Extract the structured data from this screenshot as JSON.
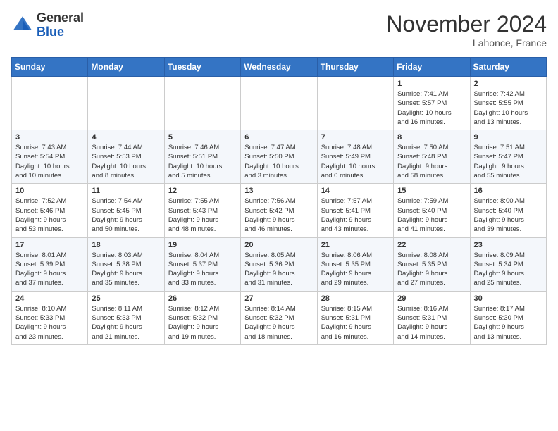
{
  "header": {
    "logo": {
      "general": "General",
      "blue": "Blue"
    },
    "month": "November 2024",
    "location": "Lahonce, France"
  },
  "weekdays": [
    "Sunday",
    "Monday",
    "Tuesday",
    "Wednesday",
    "Thursday",
    "Friday",
    "Saturday"
  ],
  "weeks": [
    [
      {
        "day": "",
        "info": ""
      },
      {
        "day": "",
        "info": ""
      },
      {
        "day": "",
        "info": ""
      },
      {
        "day": "",
        "info": ""
      },
      {
        "day": "",
        "info": ""
      },
      {
        "day": "1",
        "info": "Sunrise: 7:41 AM\nSunset: 5:57 PM\nDaylight: 10 hours\nand 16 minutes."
      },
      {
        "day": "2",
        "info": "Sunrise: 7:42 AM\nSunset: 5:55 PM\nDaylight: 10 hours\nand 13 minutes."
      }
    ],
    [
      {
        "day": "3",
        "info": "Sunrise: 7:43 AM\nSunset: 5:54 PM\nDaylight: 10 hours\nand 10 minutes."
      },
      {
        "day": "4",
        "info": "Sunrise: 7:44 AM\nSunset: 5:53 PM\nDaylight: 10 hours\nand 8 minutes."
      },
      {
        "day": "5",
        "info": "Sunrise: 7:46 AM\nSunset: 5:51 PM\nDaylight: 10 hours\nand 5 minutes."
      },
      {
        "day": "6",
        "info": "Sunrise: 7:47 AM\nSunset: 5:50 PM\nDaylight: 10 hours\nand 3 minutes."
      },
      {
        "day": "7",
        "info": "Sunrise: 7:48 AM\nSunset: 5:49 PM\nDaylight: 10 hours\nand 0 minutes."
      },
      {
        "day": "8",
        "info": "Sunrise: 7:50 AM\nSunset: 5:48 PM\nDaylight: 9 hours\nand 58 minutes."
      },
      {
        "day": "9",
        "info": "Sunrise: 7:51 AM\nSunset: 5:47 PM\nDaylight: 9 hours\nand 55 minutes."
      }
    ],
    [
      {
        "day": "10",
        "info": "Sunrise: 7:52 AM\nSunset: 5:46 PM\nDaylight: 9 hours\nand 53 minutes."
      },
      {
        "day": "11",
        "info": "Sunrise: 7:54 AM\nSunset: 5:45 PM\nDaylight: 9 hours\nand 50 minutes."
      },
      {
        "day": "12",
        "info": "Sunrise: 7:55 AM\nSunset: 5:43 PM\nDaylight: 9 hours\nand 48 minutes."
      },
      {
        "day": "13",
        "info": "Sunrise: 7:56 AM\nSunset: 5:42 PM\nDaylight: 9 hours\nand 46 minutes."
      },
      {
        "day": "14",
        "info": "Sunrise: 7:57 AM\nSunset: 5:41 PM\nDaylight: 9 hours\nand 43 minutes."
      },
      {
        "day": "15",
        "info": "Sunrise: 7:59 AM\nSunset: 5:40 PM\nDaylight: 9 hours\nand 41 minutes."
      },
      {
        "day": "16",
        "info": "Sunrise: 8:00 AM\nSunset: 5:40 PM\nDaylight: 9 hours\nand 39 minutes."
      }
    ],
    [
      {
        "day": "17",
        "info": "Sunrise: 8:01 AM\nSunset: 5:39 PM\nDaylight: 9 hours\nand 37 minutes."
      },
      {
        "day": "18",
        "info": "Sunrise: 8:03 AM\nSunset: 5:38 PM\nDaylight: 9 hours\nand 35 minutes."
      },
      {
        "day": "19",
        "info": "Sunrise: 8:04 AM\nSunset: 5:37 PM\nDaylight: 9 hours\nand 33 minutes."
      },
      {
        "day": "20",
        "info": "Sunrise: 8:05 AM\nSunset: 5:36 PM\nDaylight: 9 hours\nand 31 minutes."
      },
      {
        "day": "21",
        "info": "Sunrise: 8:06 AM\nSunset: 5:35 PM\nDaylight: 9 hours\nand 29 minutes."
      },
      {
        "day": "22",
        "info": "Sunrise: 8:08 AM\nSunset: 5:35 PM\nDaylight: 9 hours\nand 27 minutes."
      },
      {
        "day": "23",
        "info": "Sunrise: 8:09 AM\nSunset: 5:34 PM\nDaylight: 9 hours\nand 25 minutes."
      }
    ],
    [
      {
        "day": "24",
        "info": "Sunrise: 8:10 AM\nSunset: 5:33 PM\nDaylight: 9 hours\nand 23 minutes."
      },
      {
        "day": "25",
        "info": "Sunrise: 8:11 AM\nSunset: 5:33 PM\nDaylight: 9 hours\nand 21 minutes."
      },
      {
        "day": "26",
        "info": "Sunrise: 8:12 AM\nSunset: 5:32 PM\nDaylight: 9 hours\nand 19 minutes."
      },
      {
        "day": "27",
        "info": "Sunrise: 8:14 AM\nSunset: 5:32 PM\nDaylight: 9 hours\nand 18 minutes."
      },
      {
        "day": "28",
        "info": "Sunrise: 8:15 AM\nSunset: 5:31 PM\nDaylight: 9 hours\nand 16 minutes."
      },
      {
        "day": "29",
        "info": "Sunrise: 8:16 AM\nSunset: 5:31 PM\nDaylight: 9 hours\nand 14 minutes."
      },
      {
        "day": "30",
        "info": "Sunrise: 8:17 AM\nSunset: 5:30 PM\nDaylight: 9 hours\nand 13 minutes."
      }
    ]
  ]
}
